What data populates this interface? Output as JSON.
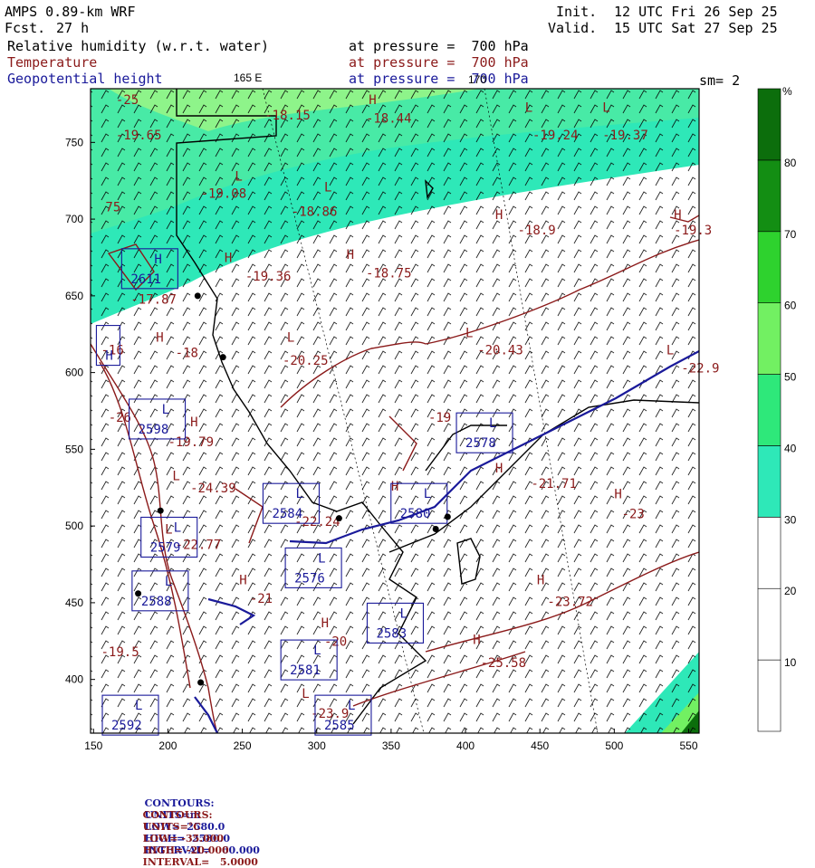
{
  "header": {
    "model": "AMPS 0.89-km WRF",
    "fcst_label": "Fcst.",
    "fcst_value": "27 h",
    "init_label": "Init.",
    "init_value": "12 UTC Fri 26 Sep 25",
    "valid_label": "Valid.",
    "valid_value": "15 UTC Sat 27 Sep 25",
    "fields": [
      {
        "name": "Relative humidity (w.r.t. water)",
        "level": "at pressure =  700 hPa",
        "color": "#000000"
      },
      {
        "name": "Temperature",
        "level": "at pressure =  700 hPa",
        "color": "#8b1a1a"
      },
      {
        "name": "Geopotential height",
        "level": "at pressure =  700 hPa",
        "color": "#1a1a9a"
      }
    ],
    "sm": "sm= 2"
  },
  "map": {
    "meridian_labels": [
      "165 E",
      "170"
    ],
    "x_ticks": [
      150,
      200,
      250,
      300,
      350,
      400,
      450,
      500,
      550
    ],
    "y_ticks": [
      750,
      700,
      650,
      600,
      550,
      500,
      450,
      400
    ],
    "x_range": [
      148,
      557
    ],
    "y_range": [
      365,
      785
    ],
    "temperature_labels": [
      {
        "x": 165,
        "y": 775,
        "t": "-25",
        "hl": ""
      },
      {
        "x": 165,
        "y": 752,
        "t": "-19.65",
        "hl": ""
      },
      {
        "x": 265,
        "y": 765,
        "t": "-18.15",
        "hl": ""
      },
      {
        "x": 335,
        "y": 775,
        "t": "H",
        "hl": "H"
      },
      {
        "x": 333,
        "y": 763,
        "t": "-18.44",
        "hl": ""
      },
      {
        "x": 445,
        "y": 752,
        "t": "-19.24",
        "hl": ""
      },
      {
        "x": 492,
        "y": 752,
        "t": "-19.37",
        "hl": ""
      },
      {
        "x": 222,
        "y": 714,
        "t": "-19.08",
        "hl": ""
      },
      {
        "x": 283,
        "y": 702,
        "t": "-18.86",
        "hl": ""
      },
      {
        "x": 158,
        "y": 705,
        "t": "75",
        "hl": ""
      },
      {
        "x": 435,
        "y": 690,
        "t": "-18.9",
        "hl": ""
      },
      {
        "x": 540,
        "y": 690,
        "t": "-19.3",
        "hl": ""
      },
      {
        "x": 252,
        "y": 660,
        "t": "-19.36",
        "hl": ""
      },
      {
        "x": 333,
        "y": 662,
        "t": "-18.75",
        "hl": ""
      },
      {
        "x": 175,
        "y": 645,
        "t": "-17.87",
        "hl": ""
      },
      {
        "x": 205,
        "y": 610,
        "t": "-18",
        "hl": ""
      },
      {
        "x": 277,
        "y": 605,
        "t": "-20.25",
        "hl": ""
      },
      {
        "x": 408,
        "y": 612,
        "t": "-20.43",
        "hl": ""
      },
      {
        "x": 545,
        "y": 600,
        "t": "-22.9",
        "hl": ""
      },
      {
        "x": 155,
        "y": 612,
        "t": "-16",
        "hl": ""
      },
      {
        "x": 160,
        "y": 568,
        "t": "-26",
        "hl": ""
      },
      {
        "x": 200,
        "y": 552,
        "t": "-19.79",
        "hl": ""
      },
      {
        "x": 375,
        "y": 568,
        "t": "-19",
        "hl": ""
      },
      {
        "x": 444,
        "y": 525,
        "t": "-21.71",
        "hl": ""
      },
      {
        "x": 215,
        "y": 522,
        "t": "-24.39",
        "hl": ""
      },
      {
        "x": 285,
        "y": 500,
        "t": "-22.24",
        "hl": ""
      },
      {
        "x": 505,
        "y": 505,
        "t": "-23",
        "hl": ""
      },
      {
        "x": 205,
        "y": 485,
        "t": "-22.77",
        "hl": ""
      },
      {
        "x": 255,
        "y": 450,
        "t": "-21",
        "hl": ""
      },
      {
        "x": 455,
        "y": 448,
        "t": "-23.72",
        "hl": ""
      },
      {
        "x": 305,
        "y": 422,
        "t": "-20",
        "hl": ""
      },
      {
        "x": 410,
        "y": 408,
        "t": "-25.58",
        "hl": ""
      },
      {
        "x": 155,
        "y": 415,
        "t": "-19.5",
        "hl": ""
      },
      {
        "x": 296,
        "y": 375,
        "t": "-23.9",
        "hl": ""
      }
    ],
    "hl_markers": [
      {
        "x": 245,
        "y": 725,
        "t": "L",
        "color": "#8b1a1a"
      },
      {
        "x": 305,
        "y": 718,
        "t": "L",
        "color": "#8b1a1a"
      },
      {
        "x": 440,
        "y": 770,
        "t": "L",
        "color": "#8b1a1a"
      },
      {
        "x": 492,
        "y": 770,
        "t": "L",
        "color": "#8b1a1a"
      },
      {
        "x": 420,
        "y": 700,
        "t": "H",
        "color": "#8b1a1a"
      },
      {
        "x": 540,
        "y": 700,
        "t": "H",
        "color": "#8b1a1a"
      },
      {
        "x": 238,
        "y": 672,
        "t": "H",
        "color": "#8b1a1a"
      },
      {
        "x": 320,
        "y": 674,
        "t": "H",
        "color": "#8b1a1a"
      },
      {
        "x": 192,
        "y": 620,
        "t": "H",
        "color": "#8b1a1a"
      },
      {
        "x": 280,
        "y": 620,
        "t": "L",
        "color": "#8b1a1a"
      },
      {
        "x": 400,
        "y": 623,
        "t": "L",
        "color": "#8b1a1a"
      },
      {
        "x": 535,
        "y": 612,
        "t": "L",
        "color": "#8b1a1a"
      },
      {
        "x": 215,
        "y": 565,
        "t": "H",
        "color": "#8b1a1a"
      },
      {
        "x": 420,
        "y": 535,
        "t": "H",
        "color": "#8b1a1a"
      },
      {
        "x": 203,
        "y": 530,
        "t": "L",
        "color": "#8b1a1a"
      },
      {
        "x": 350,
        "y": 523,
        "t": "H",
        "color": "#8b1a1a"
      },
      {
        "x": 500,
        "y": 518,
        "t": "H",
        "color": "#8b1a1a"
      },
      {
        "x": 198,
        "y": 495,
        "t": "L",
        "color": "#8b1a1a"
      },
      {
        "x": 248,
        "y": 462,
        "t": "H",
        "color": "#8b1a1a"
      },
      {
        "x": 448,
        "y": 462,
        "t": "H",
        "color": "#8b1a1a"
      },
      {
        "x": 303,
        "y": 434,
        "t": "H",
        "color": "#8b1a1a"
      },
      {
        "x": 405,
        "y": 423,
        "t": "H",
        "color": "#8b1a1a"
      },
      {
        "x": 290,
        "y": 388,
        "t": "L",
        "color": "#8b1a1a"
      }
    ],
    "height_labels": [
      {
        "x": 175,
        "y": 663,
        "t": "2611",
        "hl": "H"
      },
      {
        "x": 158,
        "y": 613,
        "t": "H",
        "hl": ""
      },
      {
        "x": 180,
        "y": 565,
        "t": "2598",
        "hl": "L"
      },
      {
        "x": 270,
        "y": 510,
        "t": "2584",
        "hl": "L"
      },
      {
        "x": 356,
        "y": 510,
        "t": "2580",
        "hl": "L"
      },
      {
        "x": 188,
        "y": 488,
        "t": "2579",
        "hl": "L"
      },
      {
        "x": 285,
        "y": 468,
        "t": "2576",
        "hl": "L"
      },
      {
        "x": 182,
        "y": 453,
        "t": "2588",
        "hl": "L"
      },
      {
        "x": 400,
        "y": 556,
        "t": "2578",
        "hl": "L"
      },
      {
        "x": 340,
        "y": 432,
        "t": "2583",
        "hl": "L"
      },
      {
        "x": 282,
        "y": 408,
        "t": "2581",
        "hl": "L"
      },
      {
        "x": 162,
        "y": 372,
        "t": "2592",
        "hl": "L"
      },
      {
        "x": 305,
        "y": 372,
        "t": "2585",
        "hl": "L"
      }
    ],
    "stations": [
      {
        "x": 220,
        "y": 650
      },
      {
        "x": 237,
        "y": 610
      },
      {
        "x": 195,
        "y": 510
      },
      {
        "x": 180,
        "y": 456
      },
      {
        "x": 222,
        "y": 398
      },
      {
        "x": 315,
        "y": 505
      },
      {
        "x": 380,
        "y": 498
      },
      {
        "x": 388,
        "y": 506
      }
    ]
  },
  "colorbar": {
    "unit": "%",
    "labels": [
      "10",
      "20",
      "30",
      "40",
      "50",
      "60",
      "70",
      "80"
    ],
    "colors": [
      "#ffffff",
      "#ffffff",
      "#ffffff",
      "#2ee8b8",
      "#2ee87a",
      "#72f062",
      "#2ed22e",
      "#138e13",
      "#0c6e0c"
    ]
  },
  "footer": {
    "line1": {
      "label": "CONTOURS:",
      "units": "UNITS=m",
      "low": "LOW=  2580.0",
      "high": "HIGH=  2580.0",
      "interval": "INTERVAL=   60.000",
      "color": "#1a1a9a"
    },
    "line2": {
      "label": "CONTOURS:",
      "units": "UNITS=°C",
      "low": "LOW= -35.000",
      "high": "HIGH= -20.000",
      "interval": "INTERVAL=   5.0000",
      "color": "#8b1a1a"
    }
  }
}
